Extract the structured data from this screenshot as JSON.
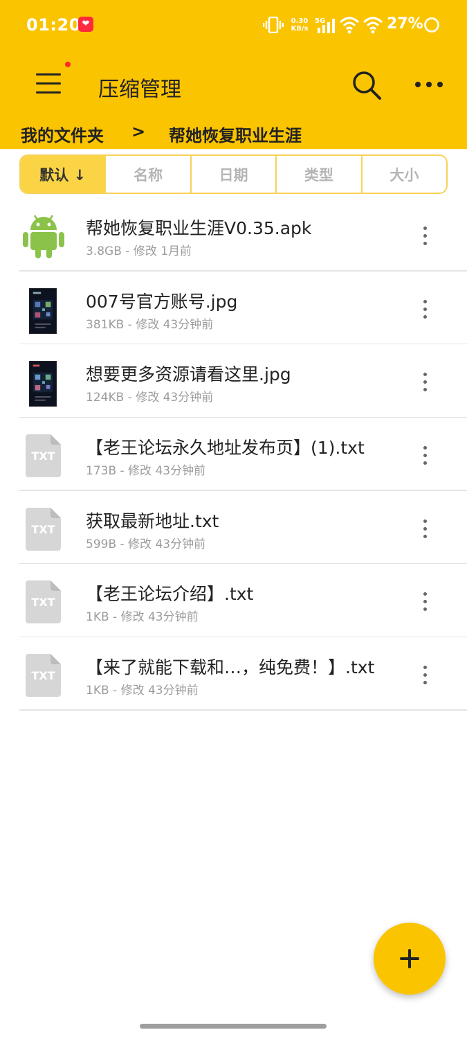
{
  "status_bar": {
    "time": "01:20",
    "app_badge": "❤",
    "net_speed_value": "0.30",
    "net_speed_unit": "KB/s",
    "network": "5G",
    "battery": "27%"
  },
  "toolbar": {
    "title": "压缩管理",
    "menu_icon": "hamburger-menu-icon",
    "search_icon": "search-icon",
    "more_icon": "more-horizontal-icon"
  },
  "breadcrumb": {
    "root": "我的文件夹",
    "separator": ">",
    "current": "帮她恢复职业生涯"
  },
  "sort_tabs": [
    {
      "label": "默认 ↓",
      "active": true
    },
    {
      "label": "名称",
      "active": false
    },
    {
      "label": "日期",
      "active": false
    },
    {
      "label": "类型",
      "active": false
    },
    {
      "label": "大小",
      "active": false
    }
  ],
  "files": [
    {
      "name": "帮她恢复职业生涯V0.35.apk",
      "meta": "3.8GB - 修改 1月前",
      "icon": "android-apk-icon"
    },
    {
      "name": "007号官方账号.jpg",
      "meta": "381KB - 修改 43分钟前",
      "icon": "image-thumbnail"
    },
    {
      "name": "想要更多资源请看这里.jpg",
      "meta": "124KB - 修改 43分钟前",
      "icon": "image-thumbnail"
    },
    {
      "name": "【老王论坛永久地址发布页】(1).txt",
      "meta": "173B - 修改 43分钟前",
      "icon": "txt-file-icon"
    },
    {
      "name": "获取最新地址.txt",
      "meta": "599B - 修改 43分钟前",
      "icon": "txt-file-icon"
    },
    {
      "name": "【老王论坛介绍】.txt",
      "meta": "1KB - 修改 43分钟前",
      "icon": "txt-file-icon"
    },
    {
      "name": "【来了就能下载和…，纯免费！】.txt",
      "meta": "1KB - 修改 43分钟前",
      "icon": "txt-file-icon"
    }
  ],
  "txt_icon_label": "TXT",
  "fab": {
    "icon": "plus-icon"
  },
  "colors": {
    "accent": "#fbc400",
    "sort_active": "#fbd446",
    "android_green": "#8bc34a",
    "txt_gray": "#d6d6d6"
  }
}
